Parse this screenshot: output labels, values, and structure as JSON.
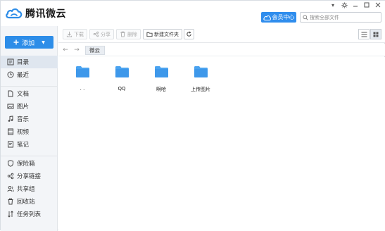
{
  "app": {
    "name": "腾讯微云",
    "vip_label": "会员中心",
    "search_placeholder": "搜索全部文件"
  },
  "window_controls": [
    "settings-icon",
    "minimize-icon",
    "maximize-icon",
    "close-icon"
  ],
  "sidebar": {
    "add_label": "添加",
    "group1": [
      {
        "label": "目录",
        "icon": "directory-icon",
        "active": true
      },
      {
        "label": "最近",
        "icon": "clock-icon",
        "active": false
      }
    ],
    "group2": [
      {
        "label": "文档",
        "icon": "document-icon"
      },
      {
        "label": "图片",
        "icon": "image-icon"
      },
      {
        "label": "音乐",
        "icon": "music-icon"
      },
      {
        "label": "视频",
        "icon": "video-icon"
      },
      {
        "label": "笔记",
        "icon": "note-icon"
      }
    ],
    "group3": [
      {
        "label": "保险箱",
        "icon": "safe-icon"
      },
      {
        "label": "分享链接",
        "icon": "share-link-icon"
      },
      {
        "label": "共享组",
        "icon": "group-icon"
      },
      {
        "label": "回收站",
        "icon": "trash-icon"
      },
      {
        "label": "任务列表",
        "icon": "task-list-icon"
      }
    ]
  },
  "toolbar": {
    "download_label": "下载",
    "share_label": "分享",
    "delete_label": "删除",
    "new_folder_label": "新建文件夹"
  },
  "breadcrumb": {
    "current": "微云"
  },
  "files": [
    {
      "name": ". ."
    },
    {
      "name": "QQ"
    },
    {
      "name": "啊哈"
    },
    {
      "name": "上传图片"
    }
  ],
  "colors": {
    "accent": "#2d8de8",
    "folder": "#4aa3f0",
    "sidebar_bg": "#f3f5f8"
  }
}
